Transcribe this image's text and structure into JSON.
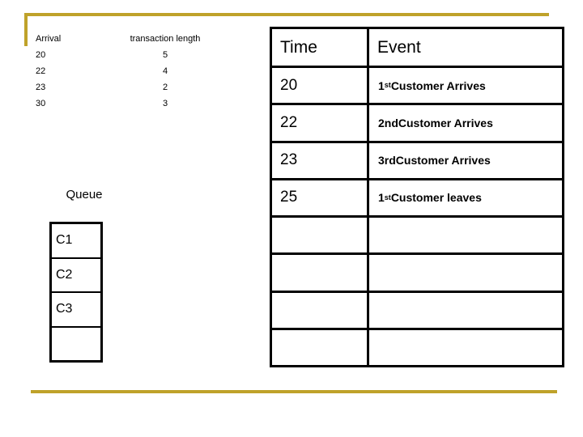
{
  "theme": {
    "accent_gold": "#bfa22a",
    "border_black": "#000000",
    "background": "#ffffff"
  },
  "arrival_table": {
    "headers": {
      "arrival": "Arrival",
      "transaction_length": "transaction length"
    },
    "rows": [
      {
        "arrival": "20",
        "length": "5"
      },
      {
        "arrival": "22",
        "length": "4"
      },
      {
        "arrival": "23",
        "length": "2"
      },
      {
        "arrival": "30",
        "length": "3"
      }
    ]
  },
  "queue": {
    "label": "Queue",
    "cells": [
      "C1",
      "C2",
      "C3",
      ""
    ]
  },
  "event_table": {
    "headers": {
      "time": "Time",
      "event": "Event"
    },
    "rows": [
      {
        "time": "20",
        "ordinal": "1",
        "ordinal_suffix": "st",
        "event_rest": " Customer Arrives",
        "event_full": "1st Customer Arrives"
      },
      {
        "time": "22",
        "ordinal": "2nd",
        "ordinal_suffix": "",
        "event_rest": " Customer Arrives",
        "event_full": "2nd Customer Arrives"
      },
      {
        "time": "23",
        "ordinal": "3rd",
        "ordinal_suffix": "",
        "event_rest": " Customer Arrives",
        "event_full": "3rd Customer Arrives"
      },
      {
        "time": "25",
        "ordinal": "1",
        "ordinal_suffix": "st",
        "event_rest": " Customer leaves",
        "event_full": "1st Customer leaves"
      },
      {
        "time": "",
        "ordinal": "",
        "ordinal_suffix": "",
        "event_rest": "",
        "event_full": ""
      },
      {
        "time": "",
        "ordinal": "",
        "ordinal_suffix": "",
        "event_rest": "",
        "event_full": ""
      },
      {
        "time": "",
        "ordinal": "",
        "ordinal_suffix": "",
        "event_rest": "",
        "event_full": ""
      },
      {
        "time": "",
        "ordinal": "",
        "ordinal_suffix": "",
        "event_rest": "",
        "event_full": ""
      }
    ]
  }
}
